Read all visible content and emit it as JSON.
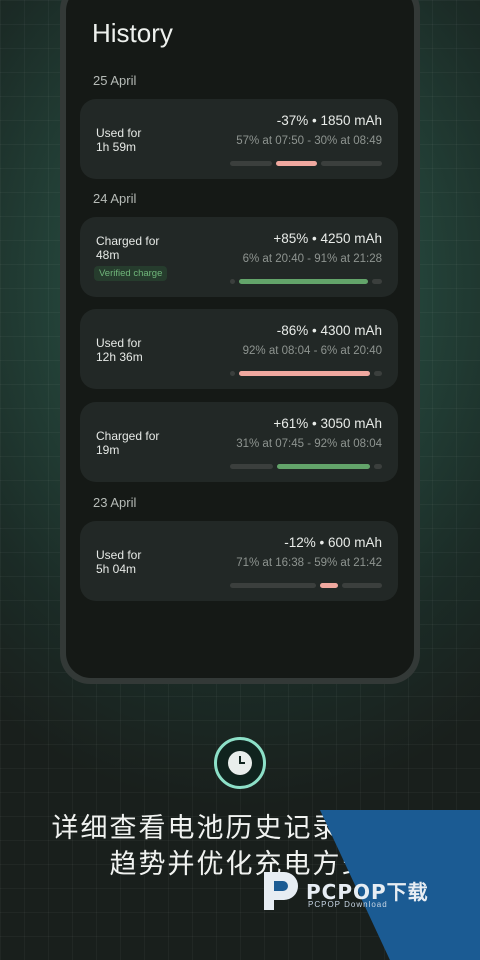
{
  "screen": {
    "title": "History",
    "groups": [
      {
        "date": "25 April"
      },
      {
        "date": "24 April"
      },
      {
        "date": "23 April"
      }
    ],
    "entries": [
      {
        "kind": "Used for",
        "duration": "1h 59m",
        "summary": "-37% • 1850 mAh",
        "range": "57% at 07:50 - 30% at 08:49",
        "type": "discharge",
        "start_pct": 57,
        "end_pct": 30
      },
      {
        "kind": "Charged for",
        "duration": "48m",
        "badge": "Verified charge",
        "summary": "+85% • 4250 mAh",
        "range": "6% at 20:40 - 91% at 21:28",
        "type": "charge",
        "start_pct": 6,
        "end_pct": 91
      },
      {
        "kind": "Used for",
        "duration": "12h 36m",
        "summary": "-86% • 4300 mAh",
        "range": "92% at 08:04 - 6% at 20:40",
        "type": "discharge",
        "start_pct": 92,
        "end_pct": 6
      },
      {
        "kind": "Charged for",
        "duration": "19m",
        "summary": "+61% • 3050 mAh",
        "range": "31% at 07:45 - 92% at 08:04",
        "type": "charge",
        "start_pct": 31,
        "end_pct": 92
      },
      {
        "kind": "Used for",
        "duration": "5h 04m",
        "summary": "-12% • 600 mAh",
        "range": "71% at 16:38 - 59% at 21:42",
        "type": "discharge",
        "start_pct": 71,
        "end_pct": 59
      }
    ]
  },
  "feature_icon": "clock-icon",
  "caption": {
    "line1": "详细查看电池历史记录，洞悉",
    "line2": "趋势并优化充电方式"
  },
  "watermark": {
    "brand": "PCPOP下载",
    "sub": "PCPOP Download"
  },
  "colors": {
    "discharge": "#f0a89f",
    "charge": "#63a46a",
    "accent_ring": "#8de0c8"
  }
}
